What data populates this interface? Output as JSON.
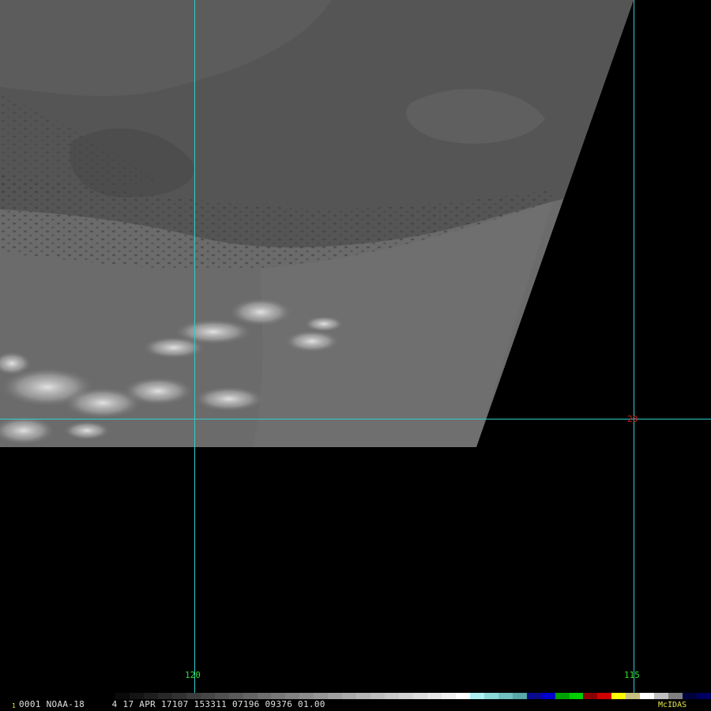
{
  "image": {
    "latitude_labels": [
      "20"
    ],
    "longitude_labels": [
      "120",
      "115"
    ]
  },
  "status_bar": {
    "frame_subscript": "1",
    "text": "0001 NOAA-18     4 17 APR 17107 153311 07196 09376 01.00",
    "product": "McIDAS"
  },
  "colors": {
    "grid_line": "#33cccc",
    "longitude_label": "#33dd33",
    "latitude_label": "#cc2222",
    "status_text": "#e0e0e0",
    "product_label": "#e8e84a",
    "background": "#000000",
    "cloud_deck": "#5a5a5a",
    "clear_region": "#6e6e6e"
  },
  "colorbar": [
    "#0a0a0a",
    "#141414",
    "#1e1e1e",
    "#282828",
    "#323232",
    "#3c3c3c",
    "#464646",
    "#505050",
    "#5a5a5a",
    "#646464",
    "#6e6e6e",
    "#787878",
    "#828282",
    "#8c8c8c",
    "#969696",
    "#a0a0a0",
    "#aaaaaa",
    "#b4b4b4",
    "#bebebe",
    "#c8c8c8",
    "#d2d2d2",
    "#dcdcdc",
    "#e6e6e6",
    "#f0f0f0",
    "#ffffff",
    "#aef0f0",
    "#8adada",
    "#70c0c0",
    "#5aa8a8",
    "#0a0a8c",
    "#0000cc",
    "#00a000",
    "#00d000",
    "#8c0000",
    "#d00000",
    "#ffff00",
    "#c8c080",
    "#ffffff",
    "#c0c0c0",
    "#808080",
    "#000040",
    "#000060"
  ]
}
